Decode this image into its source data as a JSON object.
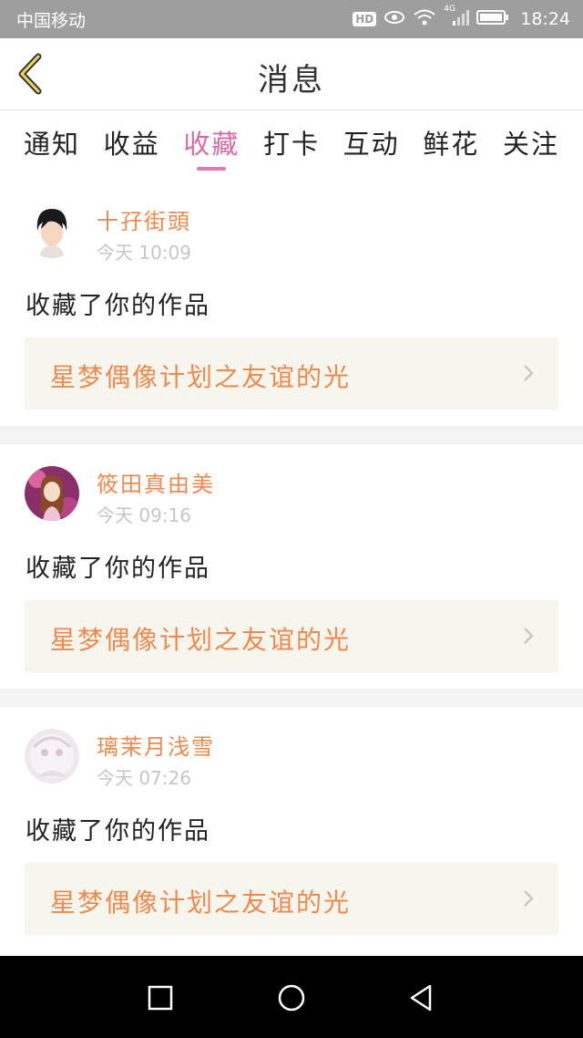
{
  "status_bar": {
    "carrier": "中国移动",
    "hd_badge": "HD",
    "network_label": "4G",
    "time": "18:24"
  },
  "header": {
    "back_icon": "chevron-left-icon",
    "title": "消息"
  },
  "tabs": [
    {
      "label": "通知",
      "active": false
    },
    {
      "label": "收益",
      "active": false
    },
    {
      "label": "收藏",
      "active": true
    },
    {
      "label": "打卡",
      "active": false
    },
    {
      "label": "互动",
      "active": false
    },
    {
      "label": "鲜花",
      "active": false
    },
    {
      "label": "关注",
      "active": false
    }
  ],
  "colors": {
    "accent_pink": "#d96aa5",
    "name_orange": "#f0894d",
    "link_bg": "#f6f5ee"
  },
  "messages": [
    {
      "user": "十孖街頭",
      "time": "今天 10:09",
      "action": "收藏了你的作品",
      "work": "星梦偶像计划之友谊的光"
    },
    {
      "user": "筱田真由美",
      "time": "今天 09:16",
      "action": "收藏了你的作品",
      "work": "星梦偶像计划之友谊的光"
    },
    {
      "user": "璃茉月浅雪",
      "time": "今天 07:26",
      "action": "收藏了你的作品",
      "work": "星梦偶像计划之友谊的光"
    }
  ],
  "nav_bar": {
    "recents_icon": "square-icon",
    "home_icon": "circle-icon",
    "back_icon": "triangle-back-icon"
  }
}
